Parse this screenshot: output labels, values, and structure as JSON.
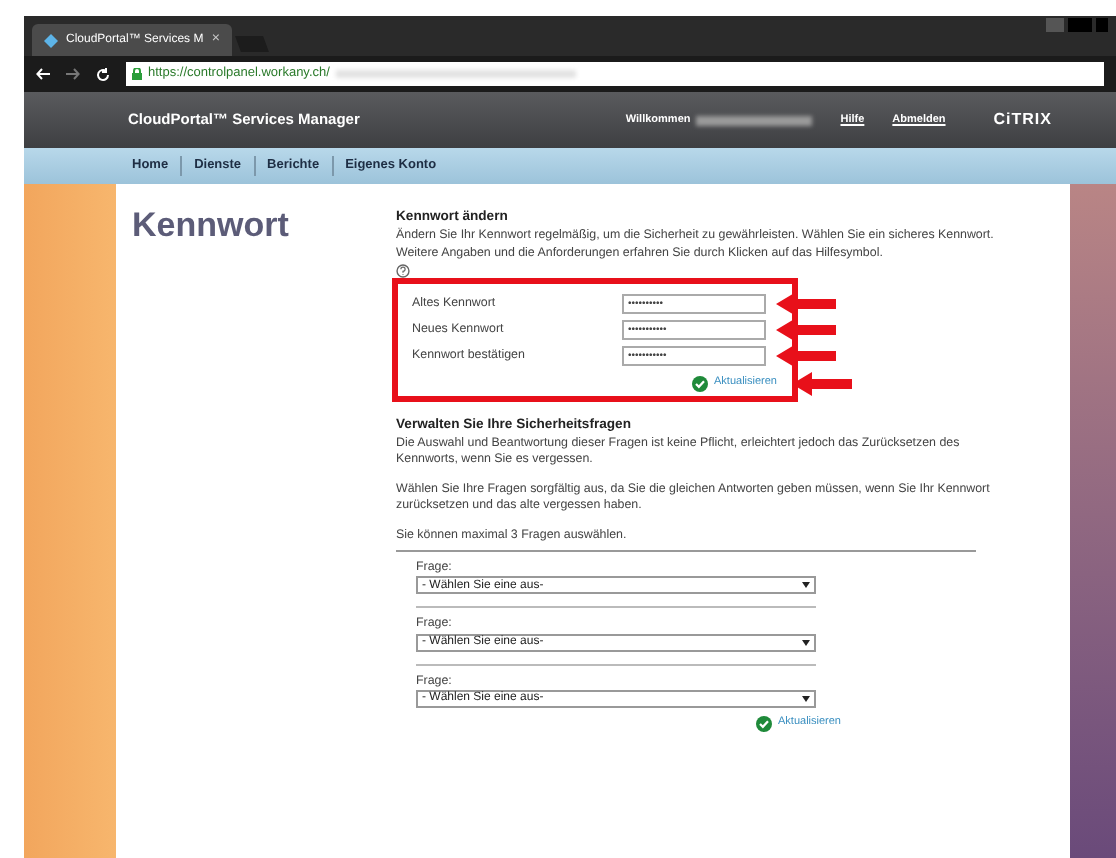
{
  "browser": {
    "tab_title": "CloudPortal™ Services M",
    "tab_close": "×",
    "url": "https://controlpanel.workany.ch/"
  },
  "header": {
    "brand": "CloudPortal™ Services Manager",
    "welcome": "Willkommen",
    "links": [
      "Hilfe",
      "Abmelden"
    ],
    "logo": "CiTRIX"
  },
  "nav": [
    "Home",
    "Dienste",
    "Berichte",
    "Eigenes Konto"
  ],
  "page_title": "Kennwort",
  "change_password": {
    "heading": "Kennwort ändern",
    "intro": "Ändern Sie Ihr Kennwort regelmäßig, um die Sicherheit zu gewährleisten. Wählen Sie ein sicheres Kennwort. Weitere Angaben und die Anforderungen erfahren Sie durch Klicken auf das Hilfesymbol.",
    "fields": [
      {
        "label": "Altes Kennwort",
        "value": "••••••••••"
      },
      {
        "label": "Neues Kennwort",
        "value": "•••••••••••"
      },
      {
        "label": "Kennwort bestätigen",
        "value": "•••••••••••"
      }
    ],
    "submit": "Aktualisieren"
  },
  "security": {
    "heading": "Verwalten Sie Ihre Sicherheitsfragen",
    "paragraphs": [
      "Die Auswahl und Beantwortung dieser Fragen ist keine Pflicht, erleichtert jedoch das Zurücksetzen des Kennworts, wenn Sie es vergessen.",
      "Wählen Sie Ihre Fragen sorgfältig aus, da Sie die gleichen Antworten geben müssen, wenn Sie Ihr Kennwort zurücksetzen und das alte vergessen haben.",
      "Sie können maximal 3 Fragen auswählen."
    ],
    "questions": [
      {
        "label": "Frage:",
        "value": "- Wählen Sie eine aus-"
      },
      {
        "label": "Frage:",
        "value": "- Wählen Sie eine aus-"
      },
      {
        "label": "Frage:",
        "value": "- Wählen Sie eine aus-"
      }
    ],
    "submit": "Aktualisieren"
  }
}
